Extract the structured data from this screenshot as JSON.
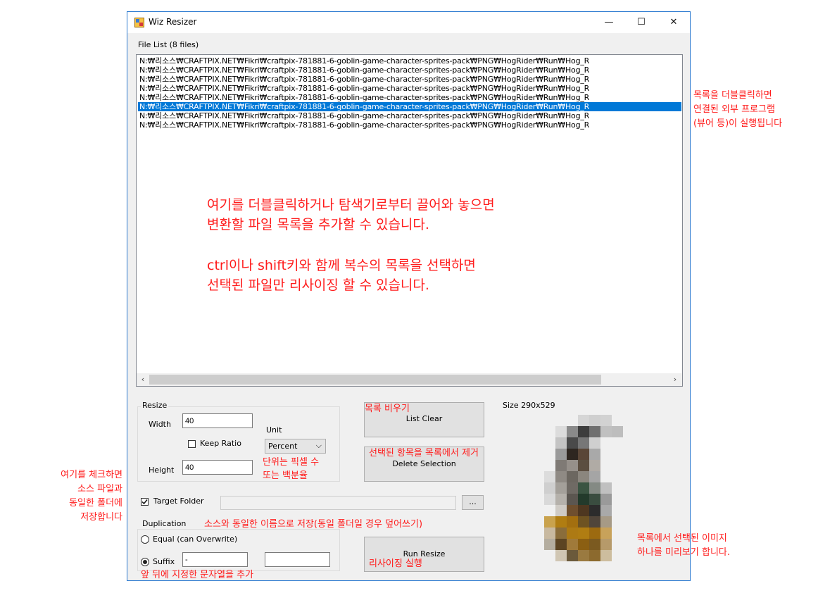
{
  "window": {
    "title": "Wiz Resizer",
    "minimize": "—",
    "maximize": "☐",
    "close": "✕"
  },
  "file_list": {
    "label": "File List (8 files)",
    "rows": [
      "N:₩리소스₩CRAFTPIX.NET₩Fikri₩craftpix-781881-6-goblin-game-character-sprites-pack₩PNG₩HogRider₩Run₩Hog_R",
      "N:₩리소스₩CRAFTPIX.NET₩Fikri₩craftpix-781881-6-goblin-game-character-sprites-pack₩PNG₩HogRider₩Run₩Hog_R",
      "N:₩리소스₩CRAFTPIX.NET₩Fikri₩craftpix-781881-6-goblin-game-character-sprites-pack₩PNG₩HogRider₩Run₩Hog_R",
      "N:₩리소스₩CRAFTPIX.NET₩Fikri₩craftpix-781881-6-goblin-game-character-sprites-pack₩PNG₩HogRider₩Run₩Hog_R",
      "N:₩리소스₩CRAFTPIX.NET₩Fikri₩craftpix-781881-6-goblin-game-character-sprites-pack₩PNG₩HogRider₩Run₩Hog_R",
      "N:₩리소스₩CRAFTPIX.NET₩Fikri₩craftpix-781881-6-goblin-game-character-sprites-pack₩PNG₩HogRider₩Run₩Hog_R",
      "N:₩리소스₩CRAFTPIX.NET₩Fikri₩craftpix-781881-6-goblin-game-character-sprites-pack₩PNG₩HogRider₩Run₩Hog_R",
      "N:₩리소스₩CRAFTPIX.NET₩Fikri₩craftpix-781881-6-goblin-game-character-sprites-pack₩PNG₩HogRider₩Run₩Hog_R"
    ],
    "selected_index": 5,
    "scroll_left": "‹",
    "scroll_right": "›",
    "overlay_line1": "여기를 더블클릭하거나 탐색기로부터 끌어와 놓으면",
    "overlay_line2": "변환할 파일 목록을 추가할 수 있습니다.",
    "overlay_line3": "ctrl이나 shift키와 함께 복수의 목록을 선택하면",
    "overlay_line4": "선택된 파일만 리사이징 할 수 있습니다."
  },
  "resize": {
    "group_label": "Resize",
    "width_label": "Width",
    "width_value": "40",
    "height_label": "Height",
    "height_value": "40",
    "keep_ratio_label": "Keep Ratio",
    "keep_ratio_checked": false,
    "unit_label": "Unit",
    "unit_value": "Percent",
    "unit_arrow": "⌵"
  },
  "buttons": {
    "list_clear": "List Clear",
    "delete_selection": "Delete Selection",
    "run_resize": "Run Resize",
    "browse": "..."
  },
  "target_folder": {
    "label": "Target Folder",
    "checked": true,
    "path": ""
  },
  "duplication": {
    "group_label": "Duplication",
    "equal_label": "Equal (can Overwrite)",
    "suffix_label": "Suffix",
    "selected": "suffix",
    "prefix_value": "-",
    "suffix_value": ""
  },
  "preview": {
    "size_label": "Size 290x529"
  },
  "annotations": {
    "dblclick_1": "목록을 더블클릭하면",
    "dblclick_2": "연결된 외부 프로그램",
    "dblclick_3": "(뷰어 등)이 실행됩니다",
    "list_clear": "목록 비우기",
    "delete_selection": "선택된 항목을 목록에서 제거",
    "unit_1": "단위는 픽셀 수",
    "unit_2": "또는 백분율",
    "target_1": "여기를 체크하면",
    "target_2": "소스 파일과",
    "target_3": "동일한 폴더에",
    "target_4": "저장합니다",
    "duplication": "소스와 동일한 이름으로 저장(동일 폴더일 경우 덮어쓰기)",
    "run_resize": "리사이징 실행",
    "suffix": "앞 뒤에 지정한 문자열을 추가",
    "preview_1": "목록에서 선택된 이미지",
    "preview_2": "하나를 미리보기 합니다."
  },
  "colors": {
    "annotation": "#ff1b1b",
    "selection": "#0078d7",
    "window_border": "#2b79d0",
    "window_bg": "#f0f0f0"
  }
}
